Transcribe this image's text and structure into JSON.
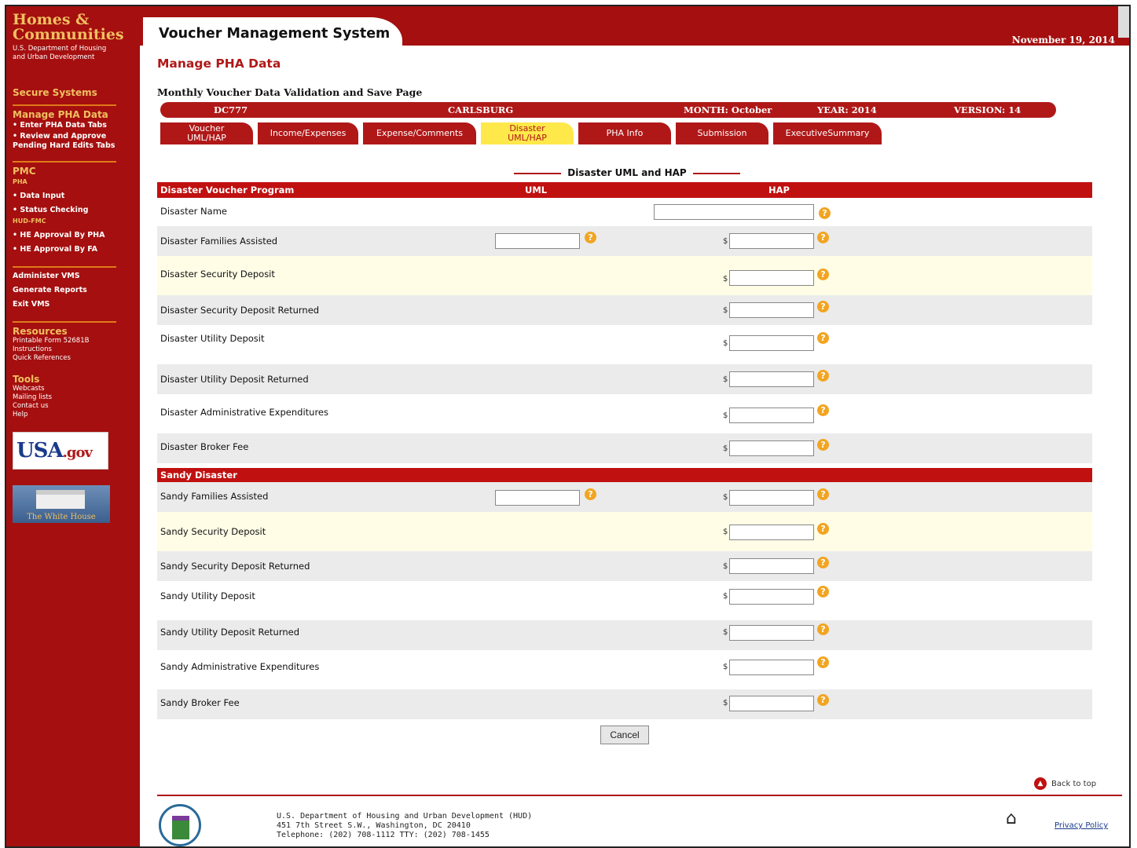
{
  "sidebar": {
    "logo_line1": "Homes &",
    "logo_line2": "Communities",
    "logo_sub1": "U.S. Department of Housing",
    "logo_sub2": "and Urban Development",
    "secure_systems": "Secure Systems",
    "manage_pha": "Manage PHA Data",
    "enter_tabs": "•  Enter PHA Data Tabs",
    "review_approve": "•  Review and Approve",
    "pending": "Pending Hard Edits Tabs",
    "pmc": "PMC",
    "pha": "PHA",
    "data_input": "•  Data Input",
    "status_checking": "•  Status Checking",
    "hud_fmc": "HUD-FMC",
    "he_pha": "•  HE Approval By PHA",
    "he_fa": "•  HE Approval By FA",
    "administer": "Administer VMS",
    "generate": "Generate Reports",
    "exit": "Exit VMS",
    "resources": "Resources",
    "printable": "Printable Form 52681B",
    "instructions": "Instructions",
    "quick_ref": "Quick References",
    "tools": "Tools",
    "webcasts": "Webcasts",
    "mailing": "Mailing lists",
    "contact": "Contact us",
    "help": "Help",
    "usa_text": "USA",
    "usa_suffix": ".gov",
    "white_house": "The White House"
  },
  "header": {
    "system_title": "Voucher Management System",
    "date": "November 19, 2014",
    "page_title": "Manage PHA Data",
    "page_subtitle": "Monthly Voucher Data Validation and Save Page"
  },
  "info_bar": {
    "pha_code": "DC777",
    "pha_name": "CARLSBURG",
    "month": "MONTH: October",
    "year": "YEAR: 2014",
    "version": "VERSION: 14"
  },
  "tabs": [
    {
      "label": "Voucher UML/HAP"
    },
    {
      "label": "Income/Expenses"
    },
    {
      "label": "Expense/Comments"
    },
    {
      "label": "Disaster UML/HAP"
    },
    {
      "label": "PHA Info"
    },
    {
      "label": "Submission"
    },
    {
      "label": "ExecutiveSummary"
    }
  ],
  "section_title": "Disaster UML and HAP",
  "disaster_table": {
    "header": "Disaster Voucher Program",
    "col_uml": "UML",
    "col_hap": "HAP",
    "rows": [
      {
        "label": "Disaster Name"
      },
      {
        "label": "Disaster Families Assisted"
      },
      {
        "label": "Disaster Security Deposit"
      },
      {
        "label": "Disaster Security Deposit Returned"
      },
      {
        "label": "Disaster Utility Deposit"
      },
      {
        "label": "Disaster Utility Deposit Returned"
      },
      {
        "label": "Disaster Administrative Expenditures"
      },
      {
        "label": "Disaster Broker Fee"
      }
    ]
  },
  "sandy_table": {
    "header": "Sandy Disaster",
    "rows": [
      {
        "label": "Sandy Families Assisted"
      },
      {
        "label": "Sandy Security Deposit"
      },
      {
        "label": "Sandy Security Deposit Returned"
      },
      {
        "label": "Sandy Utility Deposit"
      },
      {
        "label": "Sandy Utility Deposit Returned"
      },
      {
        "label": "Sandy Administrative Expenditures"
      },
      {
        "label": "Sandy Broker Fee"
      }
    ]
  },
  "dollar_sign": "$",
  "help_glyph": "?",
  "cancel_label": "Cancel",
  "footer": {
    "back_to_top": "Back to top",
    "addr1": "U.S. Department of Housing and Urban Development (HUD)",
    "addr2": "451 7th Street S.W., Washington, DC 20410",
    "addr3": "Telephone: (202) 708-1112  TTY: (202) 708-1455",
    "privacy": "Privacy Policy"
  },
  "colors": {
    "brand_red": "#a50f0f",
    "accent_gold": "#f0c060",
    "active_tab": "#ffe84a"
  }
}
